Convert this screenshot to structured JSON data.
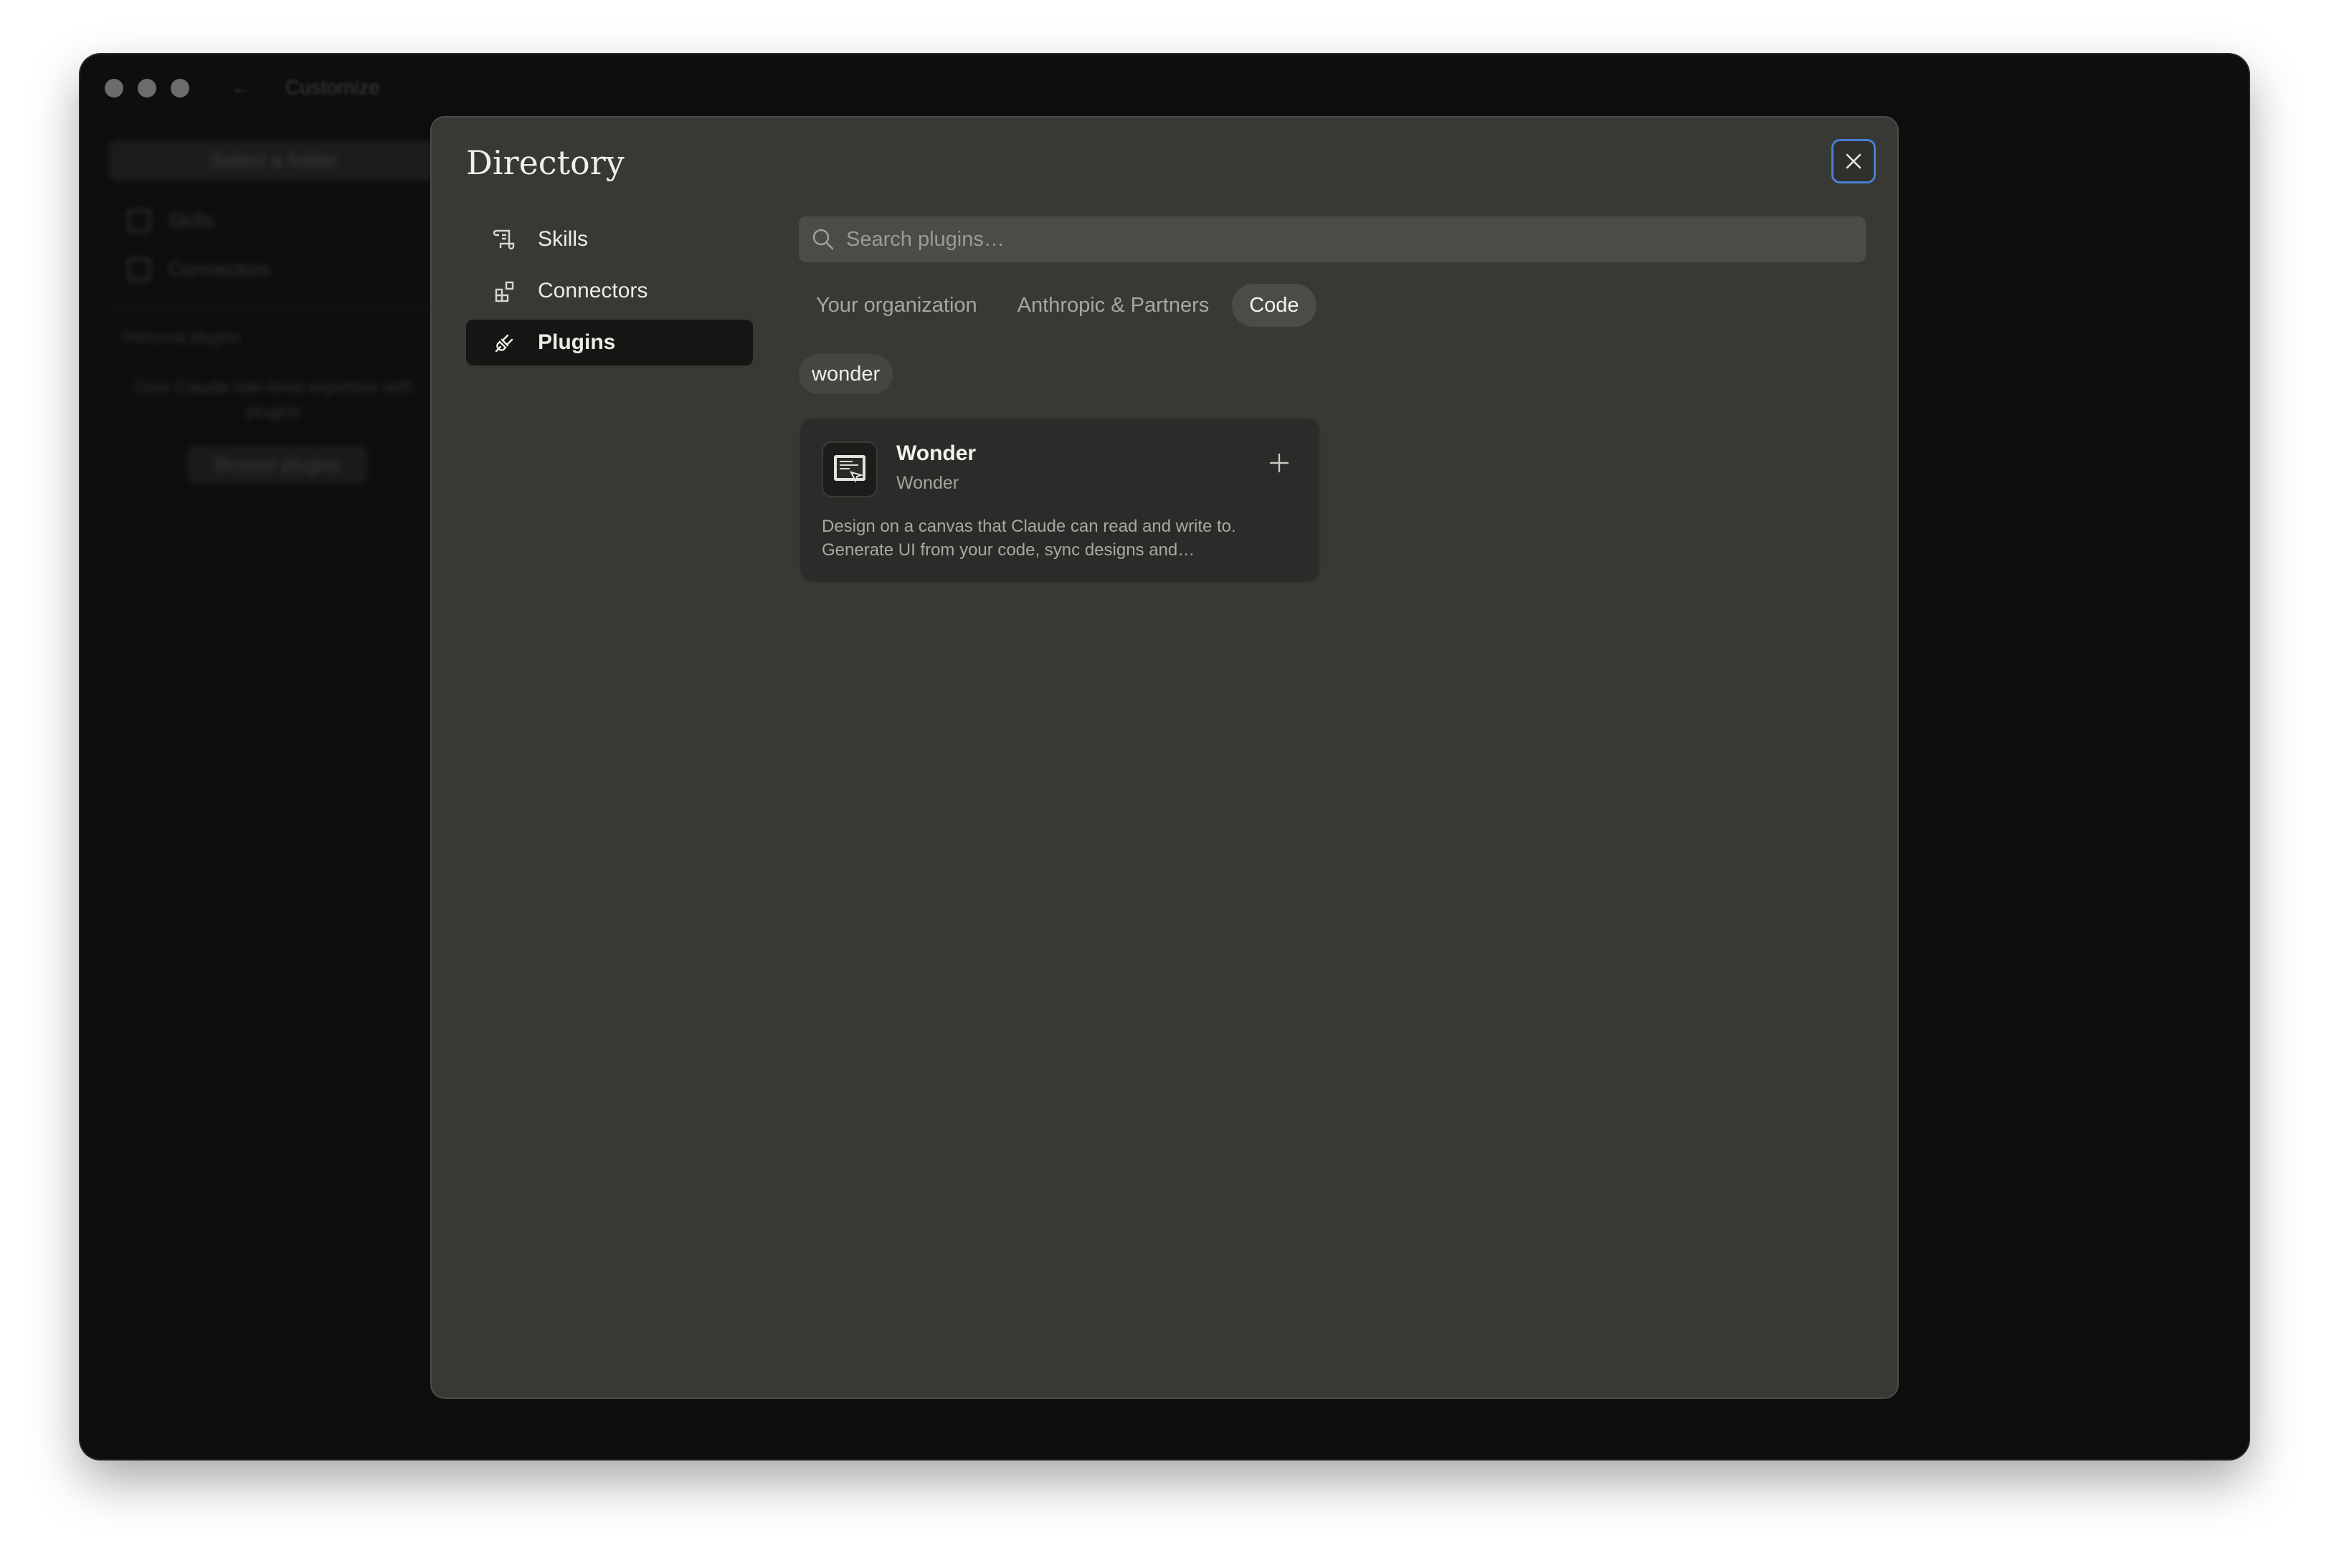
{
  "window": {
    "back_arrow": "←",
    "title": "Customize"
  },
  "background": {
    "folder_button": "Select a folder",
    "items": [
      "Skills",
      "Connectors"
    ],
    "section_label": "Personal plugins",
    "hint": "Give Claude role-level expertise with plugins",
    "browse_button": "Browse plugins"
  },
  "modal": {
    "title": "Directory",
    "close_icon": "close-icon",
    "nav": [
      {
        "label": "Skills",
        "icon": "skills-icon"
      },
      {
        "label": "Connectors",
        "icon": "connectors-icon"
      },
      {
        "label": "Plugins",
        "icon": "plug-icon",
        "active": true
      }
    ],
    "search": {
      "placeholder": "Search plugins…",
      "value": ""
    },
    "tabs": [
      {
        "label": "Your organization"
      },
      {
        "label": "Anthropic & Partners"
      },
      {
        "label": "Code",
        "active": true
      }
    ],
    "filter_chip": "wonder",
    "results": [
      {
        "name": "Wonder",
        "publisher": "Wonder",
        "description": "Design on a canvas that Claude can read and write to. Generate UI from your code, sync designs and…",
        "action_icon": "plus-icon"
      }
    ]
  },
  "colors": {
    "window_bg": "#0e0e0e",
    "modal_bg": "#383835",
    "active_nav_bg": "#151514",
    "focus_ring": "#4a7fd6"
  }
}
